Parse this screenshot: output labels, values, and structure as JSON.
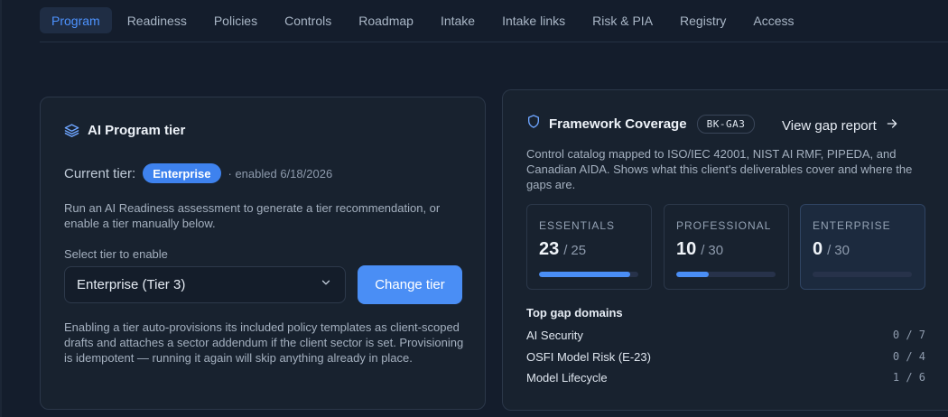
{
  "tabs": [
    "Program",
    "Readiness",
    "Policies",
    "Controls",
    "Roadmap",
    "Intake",
    "Intake links",
    "Risk & PIA",
    "Registry",
    "Access"
  ],
  "active_tab": "Program",
  "program_tier": {
    "title": "AI Program tier",
    "icon": "layers-icon",
    "current_label": "Current tier:",
    "current_value": "Enterprise",
    "enabled_text": "· enabled 6/18/2026",
    "intro": "Run an AI Readiness assessment to generate a tier recommendation, or enable a tier manually below.",
    "select_label": "Select tier to enable",
    "select_value": "Enterprise (Tier 3)",
    "change_button": "Change tier",
    "note": "Enabling a tier auto-provisions its included policy templates as client-scoped drafts and attaches a sector addendum if the client sector is set. Provisioning is idempotent — running it again will skip anything already in place."
  },
  "framework": {
    "title": "Framework Coverage",
    "icon": "shield-icon",
    "code": "BK-GA3",
    "gap_link": "View gap report",
    "description": "Control catalog mapped to ISO/IEC 42001, NIST AI RMF, PIPEDA, and Canadian AIDA. Shows what this client's deliverables cover and where the gaps are.",
    "tiers": [
      {
        "name": "ESSENTIALS",
        "covered": "23",
        "total": "25",
        "progress": 0.92,
        "selected": false
      },
      {
        "name": "PROFESSIONAL",
        "covered": "10",
        "total": "30",
        "progress": 0.33,
        "selected": false
      },
      {
        "name": "ENTERPRISE",
        "covered": "0",
        "total": "30",
        "progress": 0.0,
        "selected": true
      }
    ],
    "gap_title": "Top gap domains",
    "gaps": [
      {
        "name": "AI Security",
        "count": "0 / 7"
      },
      {
        "name": "OSFI Model Risk (E-23)",
        "count": "0 / 4"
      },
      {
        "name": "Model Lifecycle",
        "count": "1 / 6"
      }
    ]
  },
  "colors": {
    "accent": "#4a8ef5",
    "background": "#141d2c",
    "card": "#18222f"
  }
}
